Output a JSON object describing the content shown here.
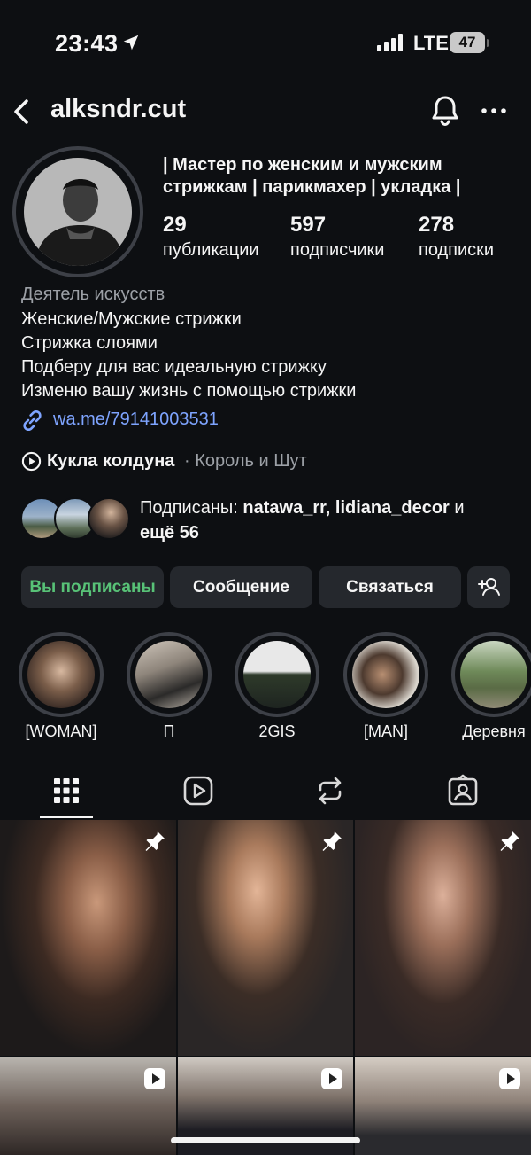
{
  "status_bar": {
    "time": "23:43",
    "network": "LTE",
    "battery": "47"
  },
  "header": {
    "username": "alksndr.cut"
  },
  "profile": {
    "name_title": "| Мастер по женским и мужским стрижкам | парикмахер | укладка |",
    "stats": [
      {
        "value": "29",
        "label": "публикации"
      },
      {
        "value": "597",
        "label": "подписчики"
      },
      {
        "value": "278",
        "label": "подписки"
      }
    ],
    "category": "Деятель искусств",
    "bio_lines": [
      "Женские/Мужские стрижки",
      "Стрижка слоями",
      "Подберу для вас идеальную стрижку",
      "Изменю вашу жизнь с помощью стрижки"
    ],
    "link": "wa.me/79141003531",
    "music": {
      "title": "Кукла колдуна",
      "separator": "·",
      "artist": "Король и Шут"
    },
    "followed_by": {
      "prefix": "Подписаны: ",
      "users": "natawa_rr, lidiana_decor",
      "suffix": " и",
      "line2": "ещё 56"
    }
  },
  "actions": {
    "following": "Вы подписаны",
    "message": "Сообщение",
    "contact": "Связаться"
  },
  "highlights": [
    {
      "label": "[WOMAN]"
    },
    {
      "label": "П"
    },
    {
      "label": "2GIS"
    },
    {
      "label": "[MAN]"
    },
    {
      "label": "Деревня"
    }
  ],
  "tabs": [
    "grid-icon",
    "reels-icon",
    "reposts-icon",
    "tagged-icon"
  ],
  "colors": {
    "background": "#0d0f12",
    "following": "#58c277",
    "link": "#7ea4ff",
    "button": "#25282d"
  }
}
